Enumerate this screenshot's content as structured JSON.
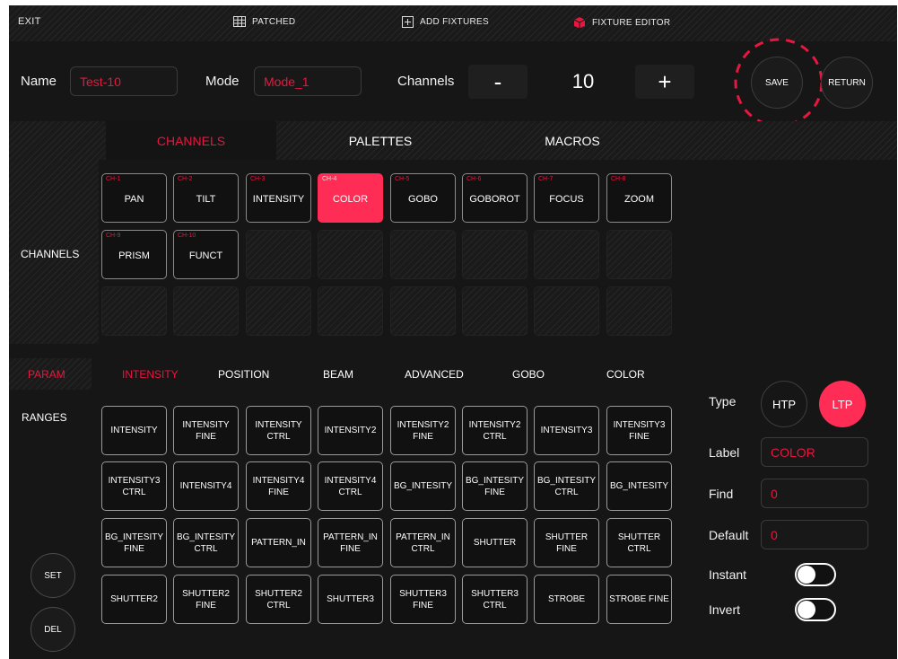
{
  "topbar": {
    "exit": "EXIT",
    "patched": "PATCHED",
    "add_fixtures": "ADD FIXTURES",
    "fixture_editor": "FIXTURE EDITOR"
  },
  "header": {
    "name_label": "Name",
    "name_value": "Test-10",
    "mode_label": "Mode",
    "mode_value": "Mode_1",
    "channels_label": "Channels",
    "minus": "-",
    "channels_value": "10",
    "plus": "+",
    "save": "SAVE",
    "return": "RETURN"
  },
  "section_tabs": [
    "CHANNELS",
    "PALETTES",
    "MACROS"
  ],
  "channels_section_label": "CHANNELS",
  "channels": [
    {
      "num": "CH-1",
      "name": "PAN"
    },
    {
      "num": "CH-2",
      "name": "TILT"
    },
    {
      "num": "CH-3",
      "name": "INTENSITY"
    },
    {
      "num": "CH-4",
      "name": "COLOR"
    },
    {
      "num": "CH-5",
      "name": "GOBO"
    },
    {
      "num": "CH-6",
      "name": "GOBOROT"
    },
    {
      "num": "CH-7",
      "name": "FOCUS"
    },
    {
      "num": "CH-8",
      "name": "ZOOM"
    },
    {
      "num": "CH-9",
      "name": "PRISM"
    },
    {
      "num": "CH-10",
      "name": "FUNCT"
    }
  ],
  "param": {
    "param_tab": "PARAM",
    "ranges_tab": "RANGES",
    "categories": [
      "INTENSITY",
      "POSITION",
      "BEAM",
      "ADVANCED",
      "GOBO",
      "COLOR"
    ],
    "buttons": [
      "INTENSITY",
      "INTENSITY FINE",
      "INTENSITY CTRL",
      "INTENSITY2",
      "INTENSITY2 FINE",
      "INTENSITY2 CTRL",
      "INTENSITY3",
      "INTENSITY3 FINE",
      "INTENSITY3 CTRL",
      "INTENSITY4",
      "INTENSITY4 FINE",
      "INTENSITY4 CTRL",
      "BG_INTESITY",
      "BG_INTESITY FINE",
      "BG_INTESITY CTRL",
      "BG_INTESITY",
      "BG_INTESITY FINE",
      "BG_INTESITY CTRL",
      "PATTERN_IN",
      "PATTERN_IN FINE",
      "PATTERN_IN CTRL",
      "SHUTTER",
      "SHUTTER FINE",
      "SHUTTER CTRL",
      "SHUTTER2",
      "SHUTTER2 FINE",
      "SHUTTER2 CTRL",
      "SHUTTER3",
      "SHUTTER3 FINE",
      "SHUTTER3 CTRL",
      "STROBE",
      "STROBE FINE"
    ],
    "set": "SET",
    "del": "DEL"
  },
  "props": {
    "type_label": "Type",
    "htp": "HTP",
    "ltp": "LTP",
    "label_label": "Label",
    "label_value": "COLOR",
    "find_label": "Find",
    "find_value": "0",
    "default_label": "Default",
    "default_value": "0",
    "instant_label": "Instant",
    "invert_label": "Invert"
  },
  "colors": {
    "accent": "#e8173f",
    "active_fill": "#ff2d55",
    "background": "#161616"
  }
}
